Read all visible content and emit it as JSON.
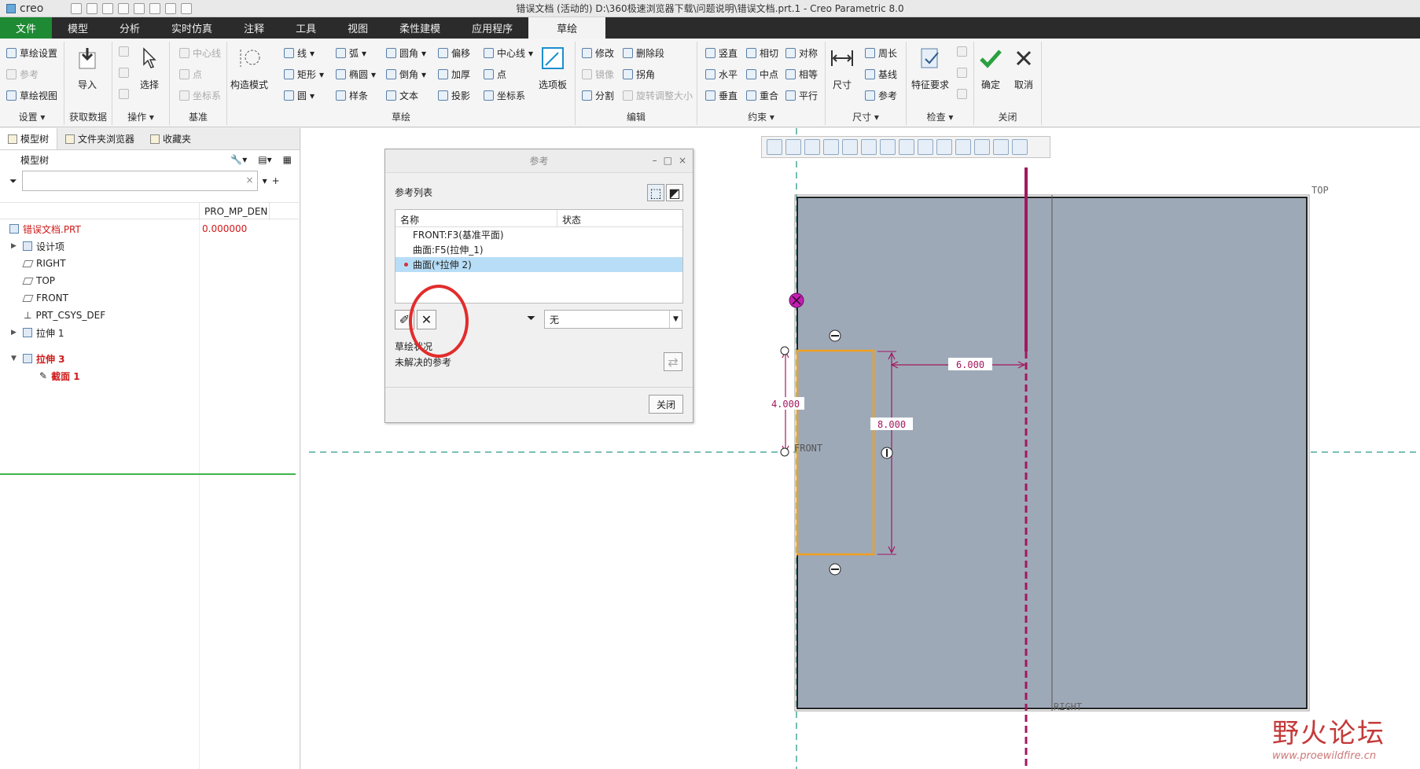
{
  "app": {
    "logo_text": "creo",
    "title": "错误文档 (活动的) D:\\360极速浏览器下载\\问题说明\\错误文档.prt.1 - Creo Parametric 8.0"
  },
  "tabs": [
    "文件",
    "模型",
    "分析",
    "实时仿真",
    "注释",
    "工具",
    "视图",
    "柔性建模",
    "应用程序",
    "草绘"
  ],
  "ribbon": {
    "setup": {
      "label": "设置",
      "items": [
        "草绘设置",
        "参考",
        "草绘视图"
      ]
    },
    "getdata": {
      "label": "获取数据",
      "import": "导入"
    },
    "ops": {
      "label": "操作",
      "select": "选择"
    },
    "datum": {
      "label": "基准",
      "items": [
        "中心线",
        "点",
        "坐标系"
      ]
    },
    "sketch": {
      "label": "草绘",
      "construct": "构造模式",
      "col1": [
        "线",
        "矩形",
        "圆"
      ],
      "col2": [
        "弧",
        "椭圆",
        "样条"
      ],
      "col3": [
        "圆角",
        "倒角",
        "文本"
      ],
      "col4": [
        "偏移",
        "加厚",
        "投影"
      ],
      "col5": [
        "中心线",
        "点",
        "坐标系"
      ],
      "palette": "选项板"
    },
    "edit": {
      "label": "编辑",
      "items": [
        "修改",
        "删除段",
        "镜像",
        "拐角",
        "分割",
        "旋转调整大小"
      ]
    },
    "constraint": {
      "label": "约束",
      "items": [
        "竖直",
        "相切",
        "对称",
        "水平",
        "中点",
        "相等",
        "垂直",
        "重合",
        "平行"
      ]
    },
    "dim": {
      "label": "尺寸",
      "big": "尺寸",
      "items": [
        "周长",
        "基线",
        "参考"
      ]
    },
    "inspect": {
      "label": "检查",
      "big": "特征要求"
    },
    "close": {
      "label": "关闭",
      "ok": "确定",
      "cancel": "取消"
    }
  },
  "leftpanel": {
    "tabs": [
      "模型树",
      "文件夹浏览器",
      "收藏夹"
    ],
    "tree_title": "模型树",
    "column": "PRO_MP_DEN",
    "root": {
      "label": "错误文档.PRT",
      "value": "0.000000"
    },
    "nodes": [
      "设计项",
      "RIGHT",
      "TOP",
      "FRONT",
      "PRT_CSYS_DEF",
      "拉伸 1"
    ],
    "active_feature": "拉伸 3",
    "active_section": "截面 1"
  },
  "dialog": {
    "title": "参考",
    "list_label": "参考列表",
    "col_name": "名称",
    "col_status": "状态",
    "refs": [
      "FRONT:F3(基准平面)",
      "曲面:F5(拉伸_1)",
      "曲面(*拉伸 2)"
    ],
    "filter_value": "无",
    "status_label": "草绘状况",
    "status_value": "未解决的参考",
    "close": "关闭"
  },
  "sketch": {
    "labels": {
      "top": "TOP",
      "right": "RIGHT",
      "front": "FRONT"
    },
    "dims": {
      "horizontal": "6.000",
      "left": "4.000",
      "height": "8.000"
    }
  },
  "watermark": {
    "main": "野火论坛",
    "url": "www.proewildfire.cn"
  },
  "colors": {
    "file_tab": "#1e8a34",
    "surface": "#9ea9b8",
    "dimension": "#a2185f",
    "outline": "#f0a020",
    "annotation": "#e22c2c"
  }
}
